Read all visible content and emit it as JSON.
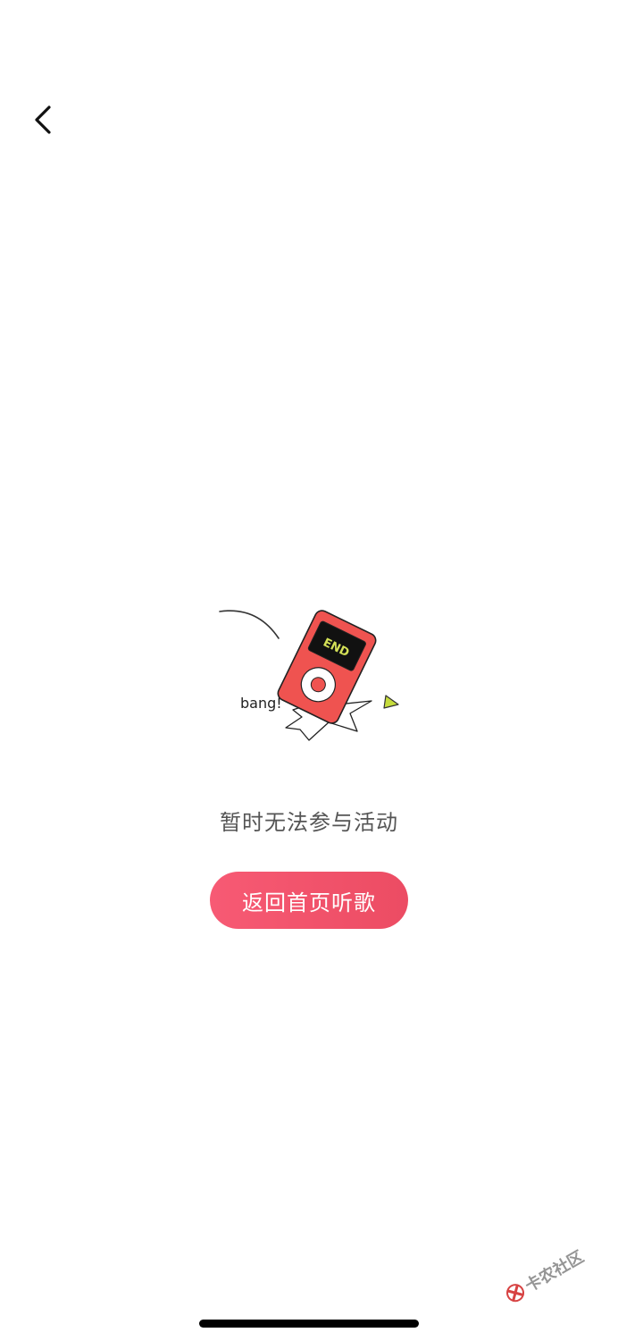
{
  "nav": {
    "back_icon": "chevron-left-icon"
  },
  "illustration": {
    "screen_text": "END",
    "caption": "bang!",
    "device_color": "#ef5350",
    "screen_text_color": "#d4e157",
    "triangle_color": "#c6dc3c"
  },
  "message": {
    "text": "暂时无法参与活动"
  },
  "home_button": {
    "label": "返回首页听歌",
    "color": "#f0506a"
  },
  "watermark": {
    "text": "卡农社区",
    "icon": "kanong-logo-icon"
  }
}
